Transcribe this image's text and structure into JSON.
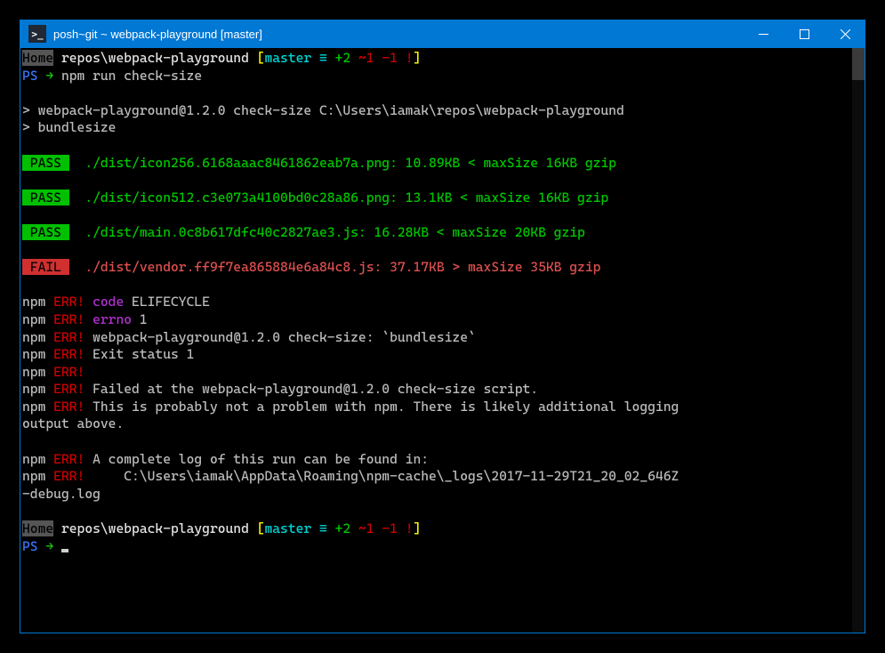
{
  "titlebar": {
    "icon_text": ">_",
    "title": "posh~git ~ webpack-playground [master]"
  },
  "prompt1": {
    "home": "Home",
    "path": " repos\\webpack-playground ",
    "lb": "[",
    "branch": "master ",
    "eq": "≡",
    "plus": " +2",
    "tilde": " ~1",
    "minus": " -1",
    "bang": " !",
    "rb": "]"
  },
  "ps1": {
    "ps": "PS",
    "arrow": " →",
    "cmd": " npm run check-size"
  },
  "out1": "> webpack-playground@1.2.0 check-size C:\\Users\\iamak\\repos\\webpack-playground",
  "out2": "> bundlesize",
  "r1": {
    "badge": " PASS ",
    "rest": "  ./dist/icon256.6168aaac8461862eab7a.png: 10.89KB < maxSize 16KB gzip"
  },
  "r2": {
    "badge": " PASS ",
    "rest": "  ./dist/icon512.c3e073a4100bd0c28a86.png: 13.1KB < maxSize 16KB gzip"
  },
  "r3": {
    "badge": " PASS ",
    "rest": "  ./dist/main.0c8b617dfc40c2827ae3.js: 16.28KB < maxSize 20KB gzip"
  },
  "r4": {
    "badge": " FAIL ",
    "rest": "  ./dist/vendor.ff9f7ea865884e6a84c8.js: 37.17KB > maxSize 35KB gzip"
  },
  "e": {
    "npm": "npm ",
    "err": "ERR!",
    "l1a": " code",
    "l1b": " ELIFECYCLE",
    "l2a": " errno",
    "l2b": " 1",
    "l3": " webpack-playground@1.2.0 check-size: `bundlesize`",
    "l4": " Exit status 1",
    "l6": " Failed at the webpack-playground@1.2.0 check-size script.",
    "l7a": " This is probably not a problem with npm. There is likely additional logging ",
    "l7b": "output above.",
    "l9": " A complete log of this run can be found in:",
    "l10a": "     C:\\Users\\iamak\\AppData\\Roaming\\npm-cache\\_logs\\2017-11-29T21_20_02_646Z",
    "l10b": "-debug.log"
  },
  "ps2": {
    "ps": "PS",
    "arrow": " →",
    "cmd": " "
  }
}
